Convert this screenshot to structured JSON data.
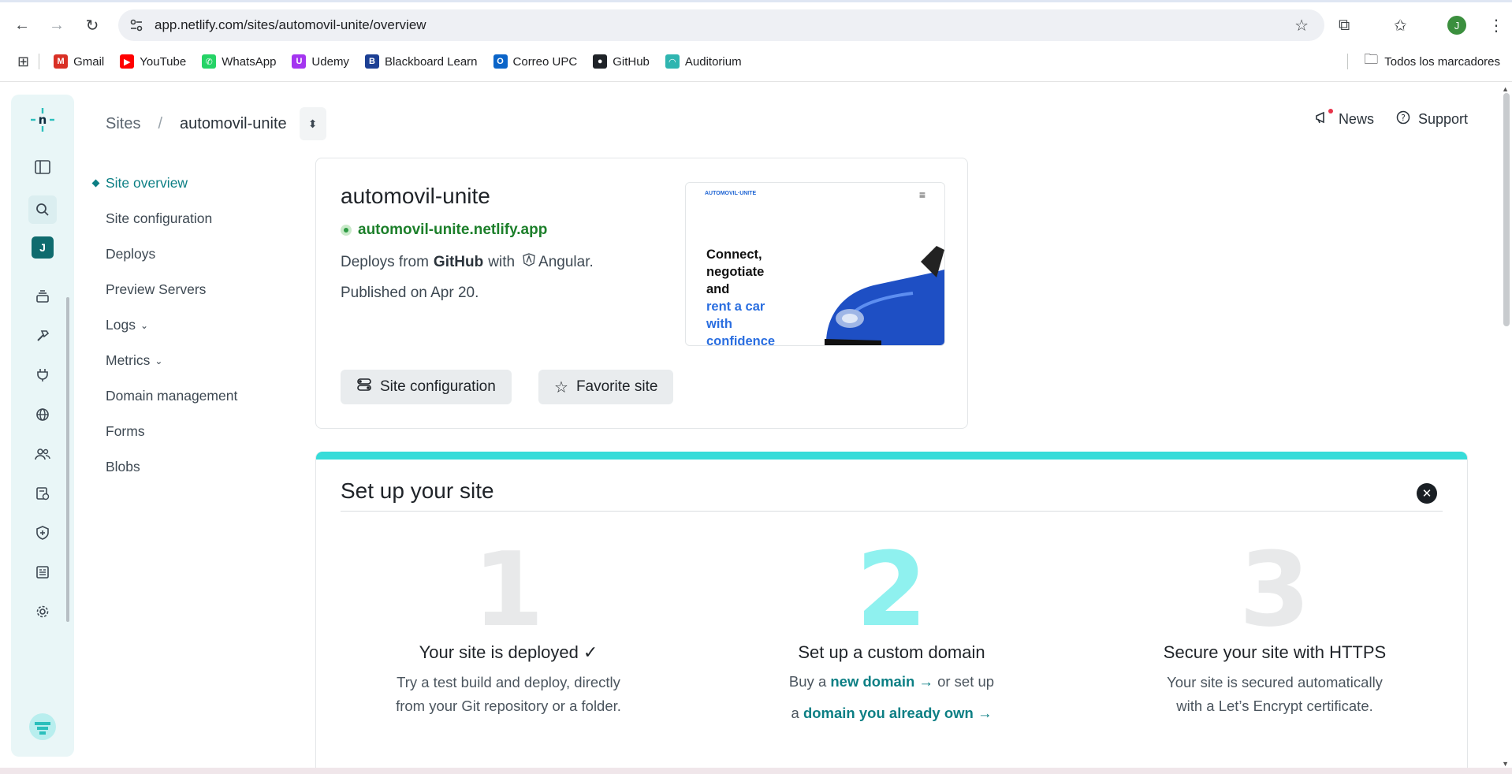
{
  "browser": {
    "url": "app.netlify.com/sites/automovil-unite/overview",
    "profile_initial": "J",
    "bookmarks": [
      {
        "label": "Gmail",
        "color": "#d93025",
        "glyph": "M"
      },
      {
        "label": "YouTube",
        "color": "#ff0000",
        "glyph": "▶"
      },
      {
        "label": "WhatsApp",
        "color": "#25d366",
        "glyph": "✆"
      },
      {
        "label": "Udemy",
        "color": "#a435f0",
        "glyph": "U"
      },
      {
        "label": "Blackboard Learn",
        "color": "#1c3f94",
        "glyph": "B"
      },
      {
        "label": "Correo UPC",
        "color": "#0a64c8",
        "glyph": "O"
      },
      {
        "label": "GitHub",
        "color": "#1f2328",
        "glyph": "●"
      },
      {
        "label": "Auditorium",
        "color": "#2fb5b0",
        "glyph": "◠"
      }
    ],
    "all_bookmarks_label": "Todos los marcadores"
  },
  "app": {
    "accent": "#0c7f84",
    "user_initial": "J",
    "breadcrumb": {
      "root": "Sites",
      "separator": "/",
      "current": "automovil-unite"
    },
    "top_actions": {
      "news": "News",
      "support": "Support"
    },
    "sidenav": [
      {
        "label": "Site overview",
        "active": true
      },
      {
        "label": "Site configuration"
      },
      {
        "label": "Deploys"
      },
      {
        "label": "Preview Servers"
      },
      {
        "label": "Logs",
        "chevron": "⌄"
      },
      {
        "label": "Metrics",
        "chevron": "⌄"
      },
      {
        "label": "Domain management"
      },
      {
        "label": "Forms"
      },
      {
        "label": "Blobs"
      }
    ],
    "site_card": {
      "name": "automovil-unite",
      "url": "automovil-unite.netlify.app",
      "deploys_prefix": "Deploys from",
      "provider": "GitHub",
      "with": "with",
      "framework": "Angular.",
      "published": "Published on Apr 20.",
      "btn_config": "Site configuration",
      "btn_favorite": "Favorite site",
      "preview": {
        "logo": "AUTOMOVIL·UNITE",
        "line1": "Connect,",
        "line2": "negotiate",
        "line3": "and",
        "line4": "rent a car",
        "line5": "with",
        "line6": "confidence"
      }
    },
    "setup": {
      "title": "Set up your site",
      "steps": [
        {
          "number": "1",
          "title": "Your site is deployed ✓",
          "desc1": "Try a test build and deploy, directly",
          "desc2": "from your Git repository or a folder.",
          "num_color": "#e8e9ea"
        },
        {
          "number": "2",
          "title": "Set up a custom domain",
          "buy": "Buy a",
          "new_domain": "new domain →",
          "or_setup": " or set up",
          "a": "a",
          "own_domain": "domain you already own →",
          "num_color": "#8ff1ef"
        },
        {
          "number": "3",
          "title": "Secure your site with HTTPS",
          "desc1": "Your site is secured automatically",
          "desc2": "with a Let’s Encrypt certificate.",
          "num_color": "#e8e9ea"
        }
      ]
    }
  }
}
